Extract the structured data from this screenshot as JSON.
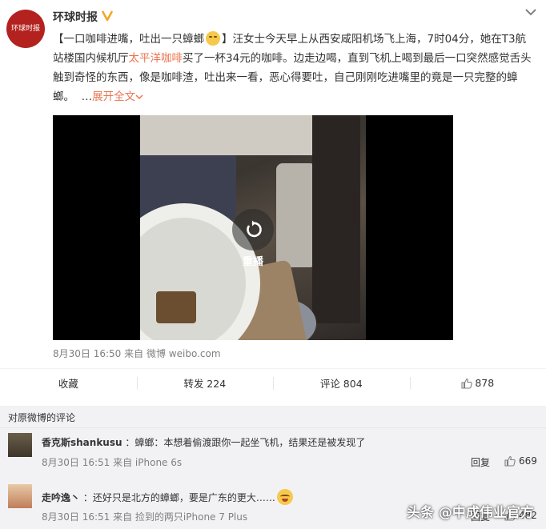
{
  "post": {
    "avatar_logo_text": "环球时报",
    "author": "环球时报",
    "verified_icon": "verified-badge-icon",
    "menu_icon": "chevron-down-icon",
    "text_parts": {
      "headline": "【一口咖啡进嘴，吐出一只蟑螂",
      "headline_end": "】",
      "body_1": "汪女士今天早上从西安咸阳机场飞上海，7时04分，她在T3航站楼国内候机厅",
      "highlight": "太平洋咖啡",
      "body_2": "买了一杯34元的咖啡。边走边喝，直到飞机上喝到最后一口突然感觉舌头触到奇怪的东西，像是咖啡渣，吐出来一看，恶心得要吐，自己刚刚吃进嘴里的竟是一只完整的蟑螂。",
      "ellipsis": "…",
      "expand_label": "展开全文"
    },
    "video": {
      "replay_label": "重播"
    },
    "meta": {
      "time": "8月30日 16:50",
      "source_prefix": "来自",
      "source": "微博 weibo.com"
    },
    "actions": {
      "favorite": "收藏",
      "repost": "转发 224",
      "comment": "评论 804",
      "like": "878"
    }
  },
  "comments": {
    "title": "对原微博的评论",
    "items": [
      {
        "name": "香克斯shankusu",
        "text": "：蟑螂：本想着偷渡跟你一起坐飞机，结果还是被发现了",
        "meta": "8月30日 16:51 来自 iPhone 6s",
        "reply": "回复",
        "likes": "669"
      },
      {
        "name": "走吟逸丶",
        "text": "：还好只是北方的蟑螂，要是广东的更大……",
        "meta": "8月30日 16:51 来自 捡到的两只iPhone 7 Plus",
        "reply": "回复",
        "likes": "482"
      }
    ]
  },
  "watermark": "头条 @中成伟业官方",
  "colors": {
    "accent": "#eb7350",
    "text": "#333333",
    "muted": "#808080",
    "comments_bg": "#f2f2f5",
    "brand_red": "#b3221f"
  }
}
